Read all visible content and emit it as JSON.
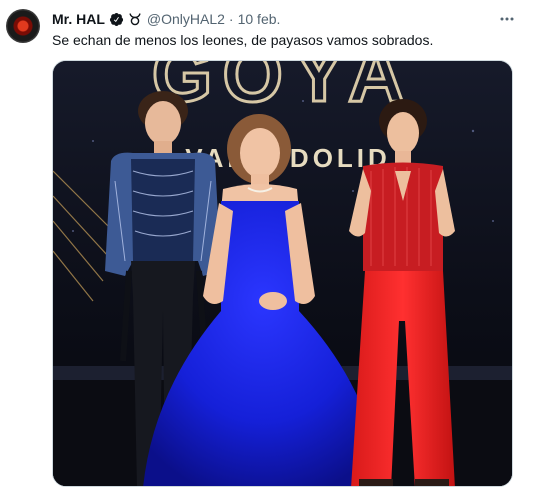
{
  "tweet": {
    "display_name": "Mr. HAL",
    "handle": "@OnlyHAL2",
    "separator": "·",
    "date": "10 feb.",
    "text": "Se echan de menos los leones, de payasos vamos sobrados.",
    "icons": {
      "avatar": "avatar-hal-eye",
      "verified": "verified-badge-icon",
      "emoji": "taurus-icon",
      "more": "more-options-icon"
    },
    "colors": {
      "verified": "#0f1419",
      "secondary_text": "#536471",
      "border": "#cfd9de"
    }
  },
  "media": {
    "backdrop_text": "GOYA",
    "backdrop_subtext": "VALLADOLID"
  }
}
